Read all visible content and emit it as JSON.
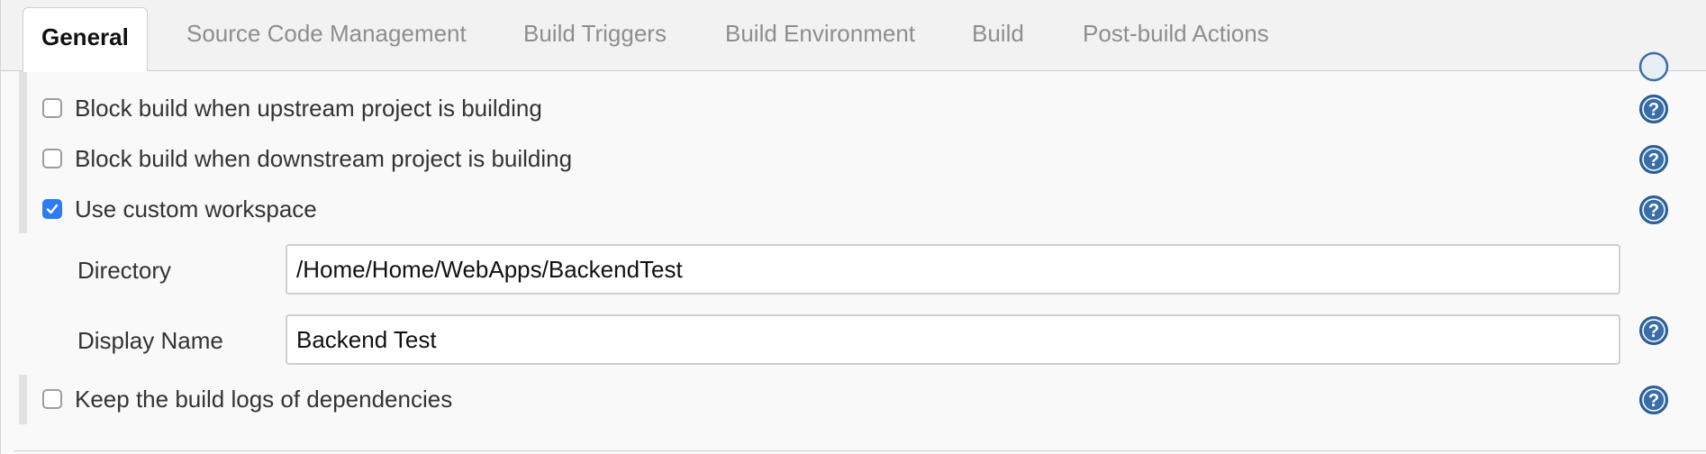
{
  "tabs": [
    {
      "label": "General",
      "active": true
    },
    {
      "label": "Source Code Management",
      "active": false
    },
    {
      "label": "Build Triggers",
      "active": false
    },
    {
      "label": "Build Environment",
      "active": false
    },
    {
      "label": "Build",
      "active": false
    },
    {
      "label": "Post-build Actions",
      "active": false
    }
  ],
  "options": [
    {
      "label": "Block build when upstream project is building",
      "checked": false
    },
    {
      "label": "Block build when downstream project is building",
      "checked": false
    },
    {
      "label": "Use custom workspace",
      "checked": true
    },
    {
      "label": "Keep the build logs of dependencies",
      "checked": false
    }
  ],
  "workspace": {
    "directory_label": "Directory",
    "directory_value": "/Home/Home/WebApps/BackendTest",
    "display_name_label": "Display Name",
    "display_name_value": "Backend Test"
  },
  "colors": {
    "checkbox_accent": "#2f7bf5",
    "help_icon": "#3a6ea8"
  },
  "icons": {
    "help": "help-icon",
    "check": "checkmark-icon"
  }
}
